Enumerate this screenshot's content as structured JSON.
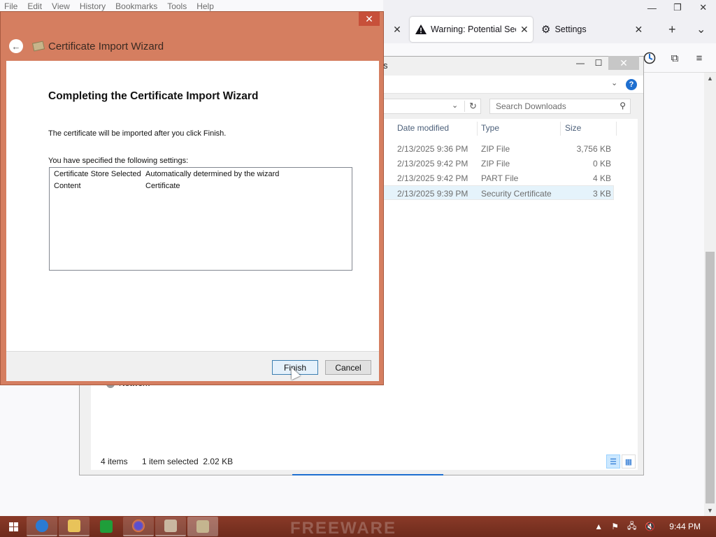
{
  "firefox": {
    "menu": [
      "File",
      "Edit",
      "View",
      "History",
      "Bookmarks",
      "Tools",
      "Help"
    ],
    "tabs": [
      {
        "label": "Warning: Potential Sec",
        "icon": "warning-icon"
      },
      {
        "label": "Settings",
        "icon": "gear-icon"
      }
    ],
    "window_controls": {
      "minimize": "—",
      "restore": "❐",
      "close": "✕"
    },
    "new_tab": "+",
    "tab_list": "⌄"
  },
  "explorer": {
    "title_tail": "s",
    "search_placeholder": "Search Downloads",
    "columns": {
      "date": "Date modified",
      "type": "Type",
      "size": "Size"
    },
    "rows": [
      {
        "date": "2/13/2025 9:36 PM",
        "type": "ZIP File",
        "size": "3,756 KB",
        "selected": false
      },
      {
        "date": "2/13/2025 9:42 PM",
        "type": "ZIP File",
        "size": "0 KB",
        "selected": false
      },
      {
        "date": "2/13/2025 9:42 PM",
        "type": "PART File",
        "size": "4 KB",
        "selected": false
      },
      {
        "date": "2/13/2025 9:39 PM",
        "type": "Security Certificate",
        "size": "3 KB",
        "selected": true
      }
    ],
    "nav_partial": "Network",
    "status_items": "4 items",
    "status_selected": "1 item selected  2.02 KB"
  },
  "wizard": {
    "window_title": "Certificate Import Wizard",
    "heading": "Completing the Certificate Import Wizard",
    "intro": "The certificate will be imported after you click Finish.",
    "settings_label": "You have specified the following settings:",
    "settings": [
      {
        "name": "Certificate Store Selected",
        "value": "Automatically determined by the wizard"
      },
      {
        "name": "Content",
        "value": "Certificate"
      }
    ],
    "finish_label": "Finish",
    "cancel_label": "Cancel",
    "close": "✕"
  },
  "taskbar": {
    "watermark": "FREEWARE",
    "clock": "9:44 PM",
    "apps": [
      {
        "name": "internet-explorer",
        "color": "#2a7bd4"
      },
      {
        "name": "file-explorer",
        "color": "#e8c35a"
      },
      {
        "name": "store",
        "color": "#1f9e3a"
      },
      {
        "name": "firefox",
        "color": "#5a4fcf"
      },
      {
        "name": "certificate-manager",
        "color": "#c9b7a0"
      },
      {
        "name": "certificate-wizard",
        "color": "#c4b58f"
      }
    ]
  },
  "colors": {
    "dialog_frame": "#d57e60",
    "taskbar": "#7a3322",
    "accent": "#1e6fd0"
  }
}
